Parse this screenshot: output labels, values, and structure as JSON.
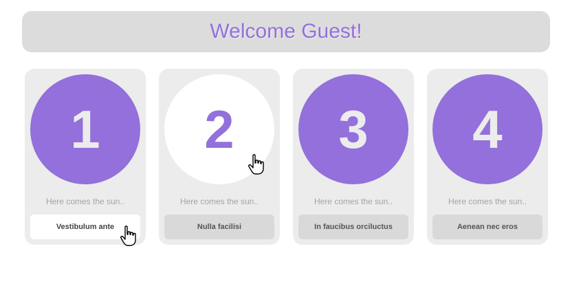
{
  "header": {
    "title": "Welcome Guest!"
  },
  "cards": [
    {
      "number": "1",
      "caption": "Here comes the sun..",
      "button_label": "Vestibulum ante"
    },
    {
      "number": "2",
      "caption": "Here comes the sun..",
      "button_label": "Nulla facilisi"
    },
    {
      "number": "3",
      "caption": "Here comes the sun..",
      "button_label": "In faucibus orciluctus"
    },
    {
      "number": "4",
      "caption": "Here comes the sun..",
      "button_label": "Aenean nec eros"
    }
  ],
  "colors": {
    "accent": "#9370db",
    "header_bg": "#dcdcdc",
    "card_bg": "#ececec",
    "button_bg": "#d9d9d9"
  },
  "icons": {
    "cursor": "hand-pointer-cursor-icon"
  }
}
